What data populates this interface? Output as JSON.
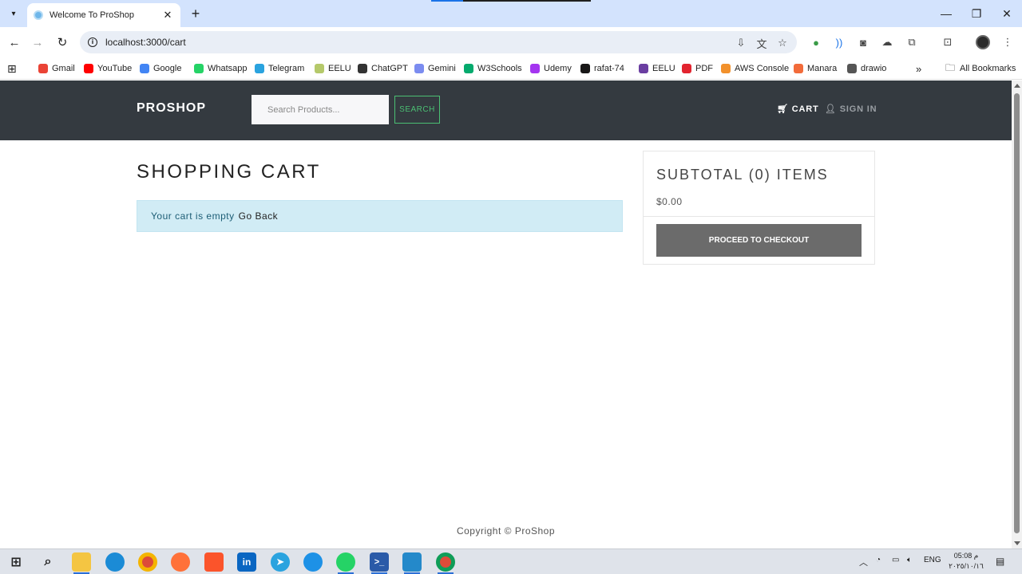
{
  "browser": {
    "tab_title": "Welcome To ProShop",
    "url": "localhost:3000/cart",
    "bookmarks": [
      {
        "label": "Gmail",
        "color": "#ea4335"
      },
      {
        "label": "YouTube",
        "color": "#ff0000"
      },
      {
        "label": "Google",
        "color": "#4285f4"
      },
      {
        "label": "Whatsapp",
        "color": "#25d366"
      },
      {
        "label": "Telegram",
        "color": "#2aa3df"
      },
      {
        "label": "EELU",
        "color": "#b5c96a"
      },
      {
        "label": "ChatGPT",
        "color": "#333333"
      },
      {
        "label": "Gemini",
        "color": "#7b8cf0"
      },
      {
        "label": "W3Schools",
        "color": "#04aa6d"
      },
      {
        "label": "Udemy",
        "color": "#a435f0"
      },
      {
        "label": "rafat-74",
        "color": "#181717"
      },
      {
        "label": "EELU",
        "color": "#6a3ea1"
      },
      {
        "label": "PDF",
        "color": "#e2242f"
      },
      {
        "label": "AWS Console",
        "color": "#f2912c"
      },
      {
        "label": "Manara",
        "color": "#f26b3a"
      },
      {
        "label": "drawio",
        "color": "#555555"
      }
    ],
    "all_bookmarks": "All Bookmarks",
    "more_bookmarks": "»"
  },
  "navbar": {
    "brand": "PROSHOP",
    "search_placeholder": "Search Products...",
    "search_button": "SEARCH",
    "cart_link": "CART",
    "signin_link": "SIGN IN"
  },
  "cart": {
    "title": "SHOPPING CART",
    "empty_message": "Your cart is empty",
    "go_back": "Go Back"
  },
  "summary": {
    "subtotal_title": "SUBTOTAL (0) ITEMS",
    "amount": "$0.00",
    "checkout_button": "PROCEED TO CHECKOUT"
  },
  "footer": {
    "copyright": "Copyright © ProShop"
  },
  "taskbar": {
    "language": "ENG",
    "time": "05:08 م",
    "date": "٢٠٢٥/١٠/١٦"
  },
  "colors": {
    "navbar_bg": "#343a40",
    "search_accent": "#4bbf73",
    "alert_bg": "#d1ecf5",
    "checkout_bg": "#6b6b6b"
  }
}
